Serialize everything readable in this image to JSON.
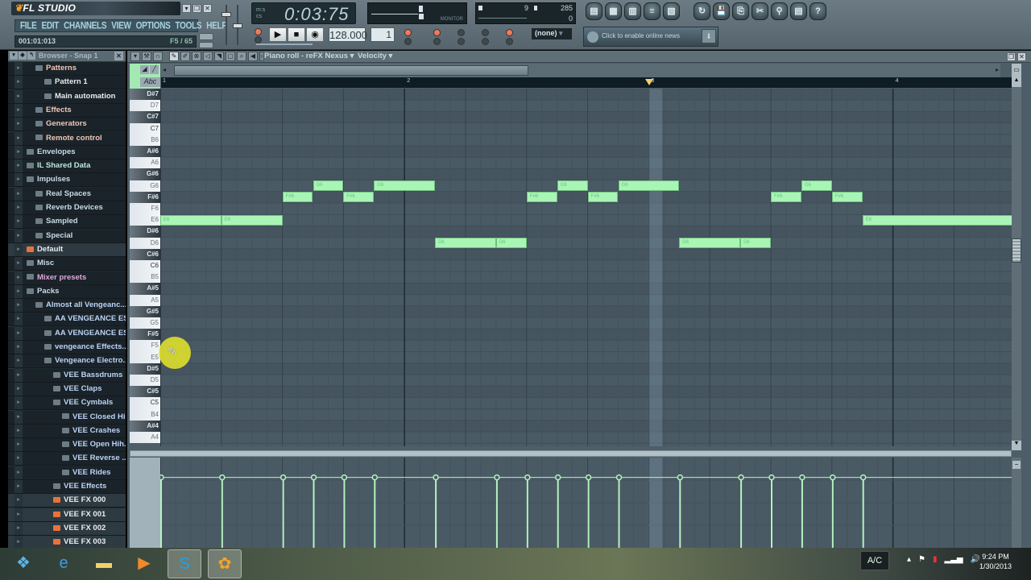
{
  "app": {
    "name": "FL STUDIO",
    "menu": [
      "FILE",
      "EDIT",
      "CHANNELS",
      "VIEW",
      "OPTIONS",
      "TOOLS",
      "HELP"
    ],
    "hint_left": "001:01:013",
    "hint_right": "F5 / 65",
    "time_display": "0:03:75",
    "time_labels": [
      "m:s",
      "cs"
    ],
    "tempo": "128.000",
    "pattern_number": "1",
    "monitor_label": "MONITOR",
    "cpu_value": "9",
    "ram_value": "285",
    "poly_value": "0",
    "pattern_select": "(none)",
    "news_text": "Click to enable online news",
    "shortcut_icons": [
      "playlist-icon",
      "step-sequencer-icon",
      "piano-roll-icon",
      "browser-icon",
      "mixer-icon",
      "undo-icon",
      "save-icon",
      "export-icon",
      "cut-icon",
      "search-icon",
      "project-info-icon",
      "help-icon"
    ],
    "shortcut_glyphs": [
      "▤",
      "▦",
      "▥",
      "≡",
      "▧",
      "↻",
      "💾",
      "⎘",
      "✂",
      "⚲",
      "▤",
      "?"
    ]
  },
  "browser": {
    "title": "Browser - Snap 1",
    "items": [
      {
        "label": "Patterns",
        "indent": 2,
        "color": "#f0c8b8",
        "icon": "pattern-icon"
      },
      {
        "label": "Pattern 1",
        "indent": 3,
        "color": "#e8ecef",
        "icon": "pattern-icon"
      },
      {
        "label": "Main automation",
        "indent": 3,
        "color": "#e8ecef",
        "icon": "pattern-icon"
      },
      {
        "label": "Effects",
        "indent": 2,
        "color": "#f0c8b8",
        "icon": "effects-icon"
      },
      {
        "label": "Generators",
        "indent": 2,
        "color": "#f0c8b8",
        "icon": "generators-icon"
      },
      {
        "label": "Remote control",
        "indent": 2,
        "color": "#f0c8b8",
        "icon": "remote-icon"
      },
      {
        "label": "Envelopes",
        "indent": 1,
        "color": "#c9dbe6",
        "icon": "folder-icon"
      },
      {
        "label": "IL Shared Data",
        "indent": 1,
        "color": "#bfeadb",
        "icon": "shared-data-icon"
      },
      {
        "label": "Impulses",
        "indent": 1,
        "color": "#c9dbe6",
        "icon": "folder-icon"
      },
      {
        "label": "Real Spaces",
        "indent": 2,
        "color": "#c9dbe6",
        "icon": "folder-icon"
      },
      {
        "label": "Reverb Devices",
        "indent": 2,
        "color": "#c9dbe6",
        "icon": "folder-icon"
      },
      {
        "label": "Sampled",
        "indent": 2,
        "color": "#c9dbe6",
        "icon": "folder-icon"
      },
      {
        "label": "Special",
        "indent": 2,
        "color": "#c9dbe6",
        "icon": "folder-icon"
      },
      {
        "label": "Default",
        "indent": 1,
        "color": "#e8ecef",
        "icon": "file-icon",
        "file": true
      },
      {
        "label": "Misc",
        "indent": 1,
        "color": "#c9dbe6",
        "icon": "folder-icon"
      },
      {
        "label": "Mixer presets",
        "indent": 1,
        "color": "#e0a8dc",
        "icon": "mixer-preset-icon"
      },
      {
        "label": "Packs",
        "indent": 1,
        "color": "#c9dbe6",
        "icon": "folder-icon"
      },
      {
        "label": "Almost all Vengeanc...",
        "indent": 2,
        "color": "#bcd4f5",
        "icon": "folder-icon"
      },
      {
        "label": "AA VENGEANCE ES...",
        "indent": 3,
        "color": "#bcd4f5",
        "icon": "folder-icon"
      },
      {
        "label": "AA VENGEANCE ES...",
        "indent": 3,
        "color": "#bcd4f5",
        "icon": "folder-icon"
      },
      {
        "label": "vengeance Effects...",
        "indent": 3,
        "color": "#bcd4f5",
        "icon": "folder-icon"
      },
      {
        "label": "Vengeance Electro...",
        "indent": 3,
        "color": "#bcd4f5",
        "icon": "folder-icon"
      },
      {
        "label": "VEE Bassdrums",
        "indent": 4,
        "color": "#bcd4f5",
        "icon": "folder-icon"
      },
      {
        "label": "VEE Claps",
        "indent": 4,
        "color": "#bcd4f5",
        "icon": "folder-icon"
      },
      {
        "label": "VEE Cymbals",
        "indent": 4,
        "color": "#bcd4f5",
        "icon": "folder-icon"
      },
      {
        "label": "VEE Closed Hi...",
        "indent": 5,
        "color": "#bcd4f5",
        "icon": "folder-icon"
      },
      {
        "label": "VEE Crashes",
        "indent": 5,
        "color": "#bcd4f5",
        "icon": "folder-icon"
      },
      {
        "label": "VEE Open Hih...",
        "indent": 5,
        "color": "#bcd4f5",
        "icon": "folder-icon"
      },
      {
        "label": "VEE Reverse ...",
        "indent": 5,
        "color": "#bcd4f5",
        "icon": "folder-icon"
      },
      {
        "label": "VEE Rides",
        "indent": 5,
        "color": "#bcd4f5",
        "icon": "folder-icon"
      },
      {
        "label": "VEE Effects",
        "indent": 4,
        "color": "#bcd4f5",
        "icon": "folder-icon"
      },
      {
        "label": "VEE FX 000",
        "indent": 4,
        "color": "#e8ecef",
        "icon": "file-icon",
        "file": true
      },
      {
        "label": "VEE FX 001",
        "indent": 4,
        "color": "#e8ecef",
        "icon": "file-icon",
        "file": true
      },
      {
        "label": "VEE FX 002",
        "indent": 4,
        "color": "#e8ecef",
        "icon": "file-icon",
        "file": true
      },
      {
        "label": "VEE FX 003",
        "indent": 4,
        "color": "#e8ecef",
        "icon": "file-icon",
        "file": true
      }
    ]
  },
  "piano_roll": {
    "title": "Piano roll - reFX Nexus",
    "target": "Velocity",
    "label_tool": "Abc",
    "bar_numbers": [
      "1",
      "2",
      "3",
      "4"
    ],
    "playhead_step": 32,
    "keys": [
      "D#7",
      "D7",
      "C#7",
      "C7",
      "B6",
      "A#6",
      "A6",
      "G#6",
      "G6",
      "F#6",
      "F6",
      "E6",
      "D#6",
      "D6",
      "C#6",
      "C6",
      "B5",
      "A#5",
      "A5",
      "G#5",
      "G5",
      "F#5",
      "F5",
      "E5",
      "D#5",
      "D5",
      "C#5",
      "C5",
      "B4",
      "A#4",
      "A4"
    ],
    "steps_per_bar": 16,
    "notes": [
      {
        "pitch": "E6",
        "start": 0,
        "length": 4,
        "velocity": 0.78
      },
      {
        "pitch": "E6",
        "start": 4,
        "length": 4,
        "velocity": 0.78
      },
      {
        "pitch": "F#6",
        "start": 8,
        "length": 2,
        "velocity": 0.78
      },
      {
        "pitch": "G6",
        "start": 10,
        "length": 2,
        "velocity": 0.78
      },
      {
        "pitch": "F#6",
        "start": 12,
        "length": 2,
        "velocity": 0.78
      },
      {
        "pitch": "G6",
        "start": 14,
        "length": 4,
        "velocity": 0.78
      },
      {
        "pitch": "D6",
        "start": 18,
        "length": 4,
        "velocity": 0.78
      },
      {
        "pitch": "D6",
        "start": 22,
        "length": 2,
        "velocity": 0.78
      },
      {
        "pitch": "F#6",
        "start": 24,
        "length": 2,
        "velocity": 0.78
      },
      {
        "pitch": "G6",
        "start": 26,
        "length": 2,
        "velocity": 0.78
      },
      {
        "pitch": "F#6",
        "start": 28,
        "length": 2,
        "velocity": 0.78
      },
      {
        "pitch": "G6",
        "start": 30,
        "length": 4,
        "velocity": 0.78
      },
      {
        "pitch": "D6",
        "start": 34,
        "length": 4,
        "velocity": 0.78
      },
      {
        "pitch": "D6",
        "start": 38,
        "length": 2,
        "velocity": 0.78
      },
      {
        "pitch": "F#6",
        "start": 40,
        "length": 2,
        "velocity": 0.78
      },
      {
        "pitch": "G6",
        "start": 42,
        "length": 2,
        "velocity": 0.78
      },
      {
        "pitch": "F#6",
        "start": 44,
        "length": 2,
        "velocity": 0.78
      },
      {
        "pitch": "E6",
        "start": 46,
        "length": 10,
        "velocity": 0.78
      }
    ]
  },
  "taskbar": {
    "apps": [
      {
        "name": "start-button",
        "glyph": "❖",
        "color": "#5fb3e8"
      },
      {
        "name": "internet-explorer-icon",
        "glyph": "e",
        "color": "#3c9be6"
      },
      {
        "name": "file-explorer-icon",
        "glyph": "▬",
        "color": "#f2d16b"
      },
      {
        "name": "media-player-icon",
        "glyph": "▶",
        "color": "#f08a2a"
      },
      {
        "name": "skype-icon",
        "glyph": "S",
        "color": "#1ea3e8"
      },
      {
        "name": "fl-studio-icon",
        "glyph": "✿",
        "color": "#f6a425"
      }
    ],
    "language": "A/C",
    "time": "9:24 PM",
    "date": "1/30/2013",
    "tray_icons": [
      "▴",
      "⚑",
      "▮",
      "▂▃▅",
      "🔊"
    ]
  }
}
